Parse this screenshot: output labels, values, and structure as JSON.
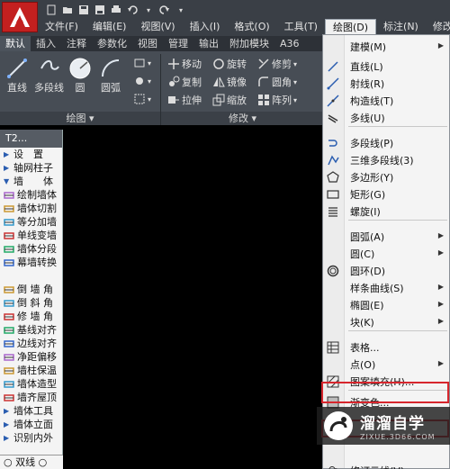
{
  "menubar": {
    "menus": [
      "文件(F)",
      "编辑(E)",
      "视图(V)",
      "插入(I)",
      "格式(O)",
      "工具(T)",
      "绘图(D)",
      "标注(N)",
      "修改"
    ],
    "active_menu": "绘图(D)"
  },
  "ribbon": {
    "tabs": [
      "默认",
      "插入",
      "注释",
      "参数化",
      "视图",
      "管理",
      "输出",
      "附加模块",
      "A36"
    ],
    "active_tab": "默认",
    "draw_panel": {
      "label": "绘图",
      "tools": [
        "直线",
        "多段线",
        "圆",
        "圆弧"
      ]
    },
    "modify_panel": {
      "label": "修改",
      "tools": [
        "移动",
        "旋转",
        "修剪",
        "复制",
        "镜像",
        "圆角",
        "拉伸",
        "缩放",
        "阵列"
      ]
    }
  },
  "palette": {
    "title": "T2...",
    "items": [
      {
        "label": "设　置",
        "type": "group"
      },
      {
        "label": "轴网柱子",
        "type": "group"
      },
      {
        "label": "墙　　体",
        "type": "group-open"
      },
      {
        "label": "绘制墙体",
        "type": "tool"
      },
      {
        "label": "墙体切割",
        "type": "tool"
      },
      {
        "label": "等分加墙",
        "type": "tool"
      },
      {
        "label": "单线变墙",
        "type": "tool"
      },
      {
        "label": "墙体分段",
        "type": "tool"
      },
      {
        "label": "幕墙转换",
        "type": "tool"
      },
      {
        "label": "",
        "type": "spacer"
      },
      {
        "label": "倒 墙 角",
        "type": "tool"
      },
      {
        "label": "倒 斜 角",
        "type": "tool"
      },
      {
        "label": "修 墙 角",
        "type": "tool"
      },
      {
        "label": "基线对齐",
        "type": "tool"
      },
      {
        "label": "边线对齐",
        "type": "tool"
      },
      {
        "label": "净距偏移",
        "type": "tool"
      },
      {
        "label": "墙柱保温",
        "type": "tool"
      },
      {
        "label": "墙体造型",
        "type": "tool"
      },
      {
        "label": "墙齐屋顶",
        "type": "tool"
      },
      {
        "label": "墙体工具",
        "type": "group"
      },
      {
        "label": "墙体立面",
        "type": "group"
      },
      {
        "label": "识别内外",
        "type": "group"
      }
    ],
    "bottom": "双线"
  },
  "draw_menu": {
    "items": [
      {
        "label": "建模(M)",
        "submenu": true,
        "icon": ""
      },
      {
        "label": "直线(L)",
        "submenu": false,
        "icon": "line-icon"
      },
      {
        "label": "射线(R)",
        "submenu": false,
        "icon": "ray-icon"
      },
      {
        "label": "构造线(T)",
        "submenu": false,
        "icon": "xline-icon"
      },
      {
        "label": "多线(U)",
        "submenu": false,
        "icon": "mline-icon"
      },
      {
        "label": "多段线(P)",
        "submenu": false,
        "icon": "polyline-icon"
      },
      {
        "label": "三维多段线(3)",
        "submenu": false,
        "icon": "3dpoly-icon"
      },
      {
        "label": "多边形(Y)",
        "submenu": false,
        "icon": "polygon-icon"
      },
      {
        "label": "矩形(G)",
        "submenu": false,
        "icon": "rectangle-icon"
      },
      {
        "label": "螺旋(I)",
        "submenu": false,
        "icon": "helix-icon"
      },
      {
        "label": "圆弧(A)",
        "submenu": true,
        "icon": ""
      },
      {
        "label": "圆(C)",
        "submenu": true,
        "icon": ""
      },
      {
        "label": "圆环(D)",
        "submenu": false,
        "icon": "donut-icon"
      },
      {
        "label": "样条曲线(S)",
        "submenu": true,
        "icon": ""
      },
      {
        "label": "椭圆(E)",
        "submenu": true,
        "icon": ""
      },
      {
        "label": "块(K)",
        "submenu": true,
        "icon": ""
      },
      {
        "label": "表格...",
        "submenu": false,
        "icon": "table-icon"
      },
      {
        "label": "点(O)",
        "submenu": true,
        "icon": ""
      },
      {
        "label": "图案填充(H)...",
        "submenu": false,
        "icon": "hatch-icon"
      },
      {
        "label": "渐变色...",
        "submenu": false,
        "icon": "gradient-icon"
      },
      {
        "label": "修订云线(V)",
        "submenu": false,
        "icon": "revcloud-icon"
      }
    ]
  },
  "watermark": {
    "title": "溜溜自学",
    "subtitle": "ZIXUE.3D66.COM"
  }
}
